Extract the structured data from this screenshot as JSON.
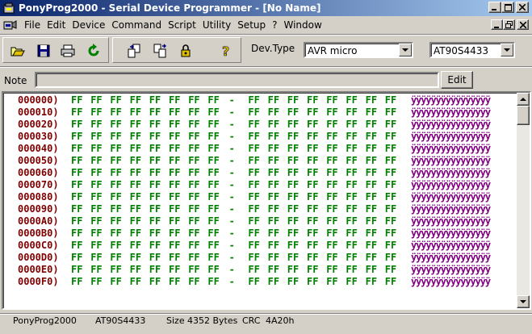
{
  "window": {
    "title": "PonyProg2000 - Serial Device Programmer - [No Name]",
    "controls": {
      "minimize": "_",
      "maximize": "□",
      "close": "×"
    }
  },
  "menu": {
    "items": [
      "File",
      "Edit",
      "Device",
      "Command",
      "Script",
      "Utility",
      "Setup",
      "?",
      "Window"
    ]
  },
  "toolbar": {
    "buttons": [
      "open-icon",
      "save-icon",
      "print-icon",
      "reload-icon",
      "read-device-icon",
      "write-device-icon",
      "lock-icon",
      "help-icon"
    ],
    "devtype_label": "Dev.Type",
    "devtype_value": "AVR micro",
    "device_value": "AT90S4433"
  },
  "note": {
    "label": "Note",
    "value": "",
    "edit_label": "Edit"
  },
  "hex": {
    "rows": [
      {
        "addr": "000000)",
        "ascii": "ÿÿÿÿÿÿÿÿÿÿÿÿÿÿÿÿ"
      },
      {
        "addr": "000010)",
        "ascii": "ÿÿÿÿÿÿÿÿÿÿÿÿÿÿÿÿ"
      },
      {
        "addr": "000020)",
        "ascii": "ÿÿÿÿÿÿÿÿÿÿÿÿÿÿÿÿ"
      },
      {
        "addr": "000030)",
        "ascii": "ÿÿÿÿÿÿÿÿÿÿÿÿÿÿÿÿ"
      },
      {
        "addr": "000040)",
        "ascii": "ÿÿÿÿÿÿÿÿÿÿÿÿÿÿÿÿ"
      },
      {
        "addr": "000050)",
        "ascii": "ÿÿÿÿÿÿÿÿÿÿÿÿÿÿÿÿ"
      },
      {
        "addr": "000060)",
        "ascii": "ÿÿÿÿÿÿÿÿÿÿÿÿÿÿÿÿ"
      },
      {
        "addr": "000070)",
        "ascii": "ÿÿÿÿÿÿÿÿÿÿÿÿÿÿÿÿ"
      },
      {
        "addr": "000080)",
        "ascii": "ÿÿÿÿÿÿÿÿÿÿÿÿÿÿÿÿ"
      },
      {
        "addr": "000090)",
        "ascii": "ÿÿÿÿÿÿÿÿÿÿÿÿÿÿÿÿ"
      },
      {
        "addr": "0000A0)",
        "ascii": "ÿÿÿÿÿÿÿÿÿÿÿÿÿÿÿÿ"
      },
      {
        "addr": "0000B0)",
        "ascii": "ÿÿÿÿÿÿÿÿÿÿÿÿÿÿÿÿ"
      },
      {
        "addr": "0000C0)",
        "ascii": "ÿÿÿÿÿÿÿÿÿÿÿÿÿÿÿÿ"
      },
      {
        "addr": "0000D0)",
        "ascii": "ÿÿÿÿÿÿÿÿÿÿÿÿÿÿÿÿ"
      },
      {
        "addr": "0000E0)",
        "ascii": "ÿÿÿÿÿÿÿÿÿÿÿÿÿÿÿÿ"
      },
      {
        "addr": "0000F0)",
        "ascii": "ÿÿÿÿÿÿÿÿÿÿÿÿÿÿÿÿ"
      }
    ],
    "byte_value": "FF",
    "separator": "-",
    "colors": {
      "address": "#800000",
      "bytes": "#008000",
      "ascii": "#800080"
    }
  },
  "status": {
    "app": "PonyProg2000",
    "device": "AT90S4433",
    "size_label": "Size",
    "size_value": "4352 Bytes",
    "crc_label": "CRC",
    "crc_value": "4A20h"
  }
}
